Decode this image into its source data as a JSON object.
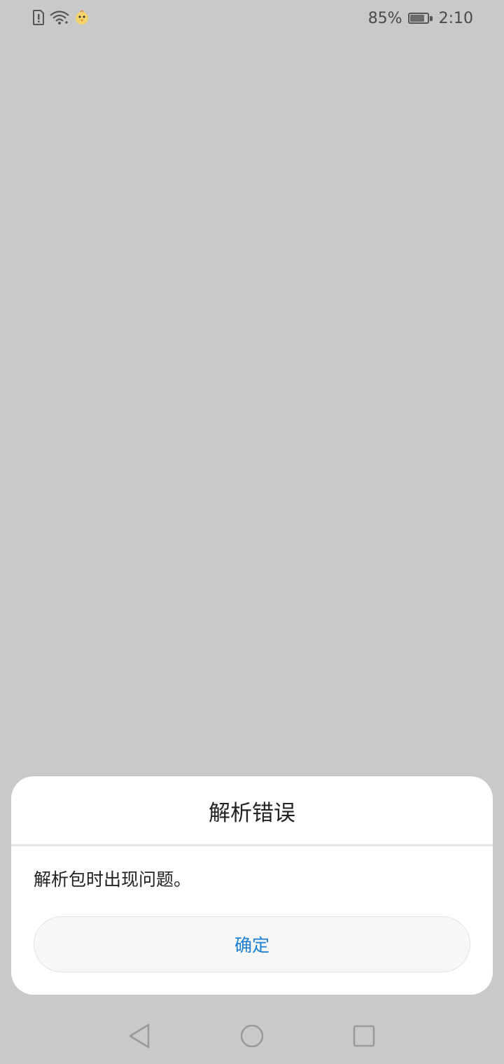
{
  "status_bar": {
    "battery_percent": "85%",
    "battery_level": 0.85,
    "time": "2:10",
    "icons": [
      "sim-alert-icon",
      "wifi-icon",
      "chick-emoji-icon"
    ]
  },
  "dialog": {
    "title": "解析错误",
    "message": "解析包时出现问题。",
    "confirm_label": "确定",
    "accent_color": "#1e7fd6"
  },
  "nav_bar": {
    "icons": [
      "back-icon",
      "home-icon",
      "recents-icon"
    ]
  }
}
